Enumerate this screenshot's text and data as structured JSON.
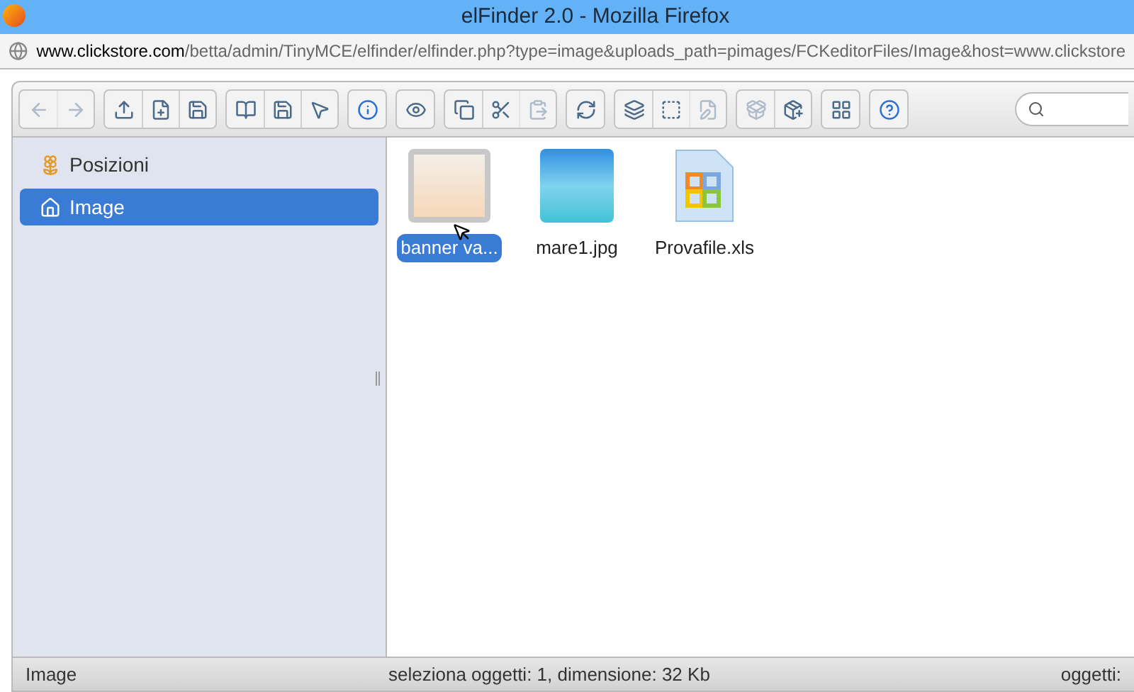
{
  "window": {
    "title": "elFinder 2.0 - Mozilla Firefox"
  },
  "address_bar": {
    "domain": "www.clickstore.com",
    "path": "/betta/admin/TinyMCE/elfinder/elfinder.php?type=image&uploads_path=pimages/FCKeditorFiles/Image&host=www.clickstore"
  },
  "toolbar": [
    [
      {
        "kind": "back",
        "disabled": true
      },
      {
        "kind": "forward",
        "disabled": true
      }
    ],
    [
      {
        "kind": "upload",
        "disabled": false
      },
      {
        "kind": "newfile",
        "disabled": false
      },
      {
        "kind": "download",
        "disabled": false
      }
    ],
    [
      {
        "kind": "open",
        "disabled": false
      },
      {
        "kind": "save",
        "disabled": false
      },
      {
        "kind": "pointer",
        "disabled": false
      }
    ],
    [
      {
        "kind": "info",
        "disabled": false
      }
    ],
    [
      {
        "kind": "preview",
        "disabled": false
      }
    ],
    [
      {
        "kind": "copy",
        "disabled": false
      },
      {
        "kind": "cut",
        "disabled": false
      },
      {
        "kind": "paste",
        "disabled": true
      }
    ],
    [
      {
        "kind": "refresh",
        "disabled": false
      }
    ],
    [
      {
        "kind": "duplicate",
        "disabled": false
      },
      {
        "kind": "rename",
        "disabled": false
      },
      {
        "kind": "edit",
        "disabled": true
      }
    ],
    [
      {
        "kind": "extract",
        "disabled": true
      },
      {
        "kind": "archive",
        "disabled": false
      }
    ],
    [
      {
        "kind": "view",
        "disabled": false
      }
    ],
    [
      {
        "kind": "help",
        "disabled": false
      }
    ]
  ],
  "sidebar": {
    "items": [
      {
        "kind": "places",
        "label": "Posizioni",
        "selected": false
      },
      {
        "kind": "home",
        "label": "Image",
        "selected": true
      }
    ]
  },
  "files": [
    {
      "kind": "banner",
      "name": "banner va...",
      "selected": true
    },
    {
      "kind": "sea",
      "name": "mare1.jpg",
      "selected": false
    },
    {
      "kind": "sheet",
      "name": "Provafile.xls",
      "selected": false
    }
  ],
  "status_bar": {
    "path": "Image",
    "selection": "seleziona oggetti: 1, dimensione: 32 Kb",
    "count": "oggetti:"
  }
}
